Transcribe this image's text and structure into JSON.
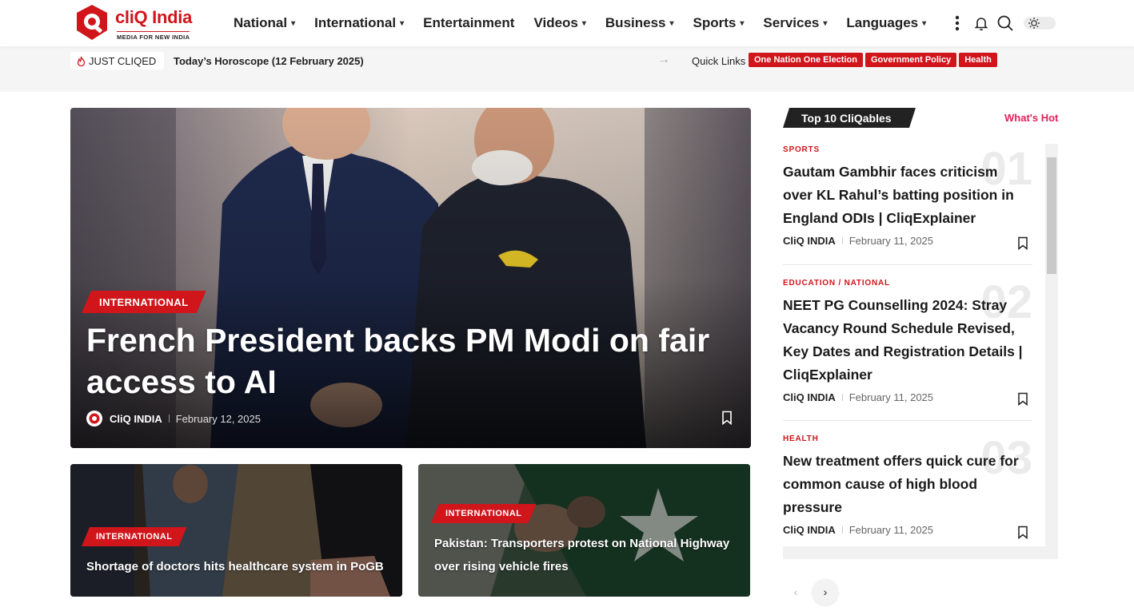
{
  "brand": {
    "name": "cliQ India",
    "tagline": "MEDIA FOR NEW INDIA"
  },
  "nav": [
    {
      "label": "National",
      "chevron": true
    },
    {
      "label": "International",
      "chevron": true
    },
    {
      "label": "Entertainment",
      "chevron": false
    },
    {
      "label": "Videos",
      "chevron": true
    },
    {
      "label": "Business",
      "chevron": true
    },
    {
      "label": "Sports",
      "chevron": true
    },
    {
      "label": "Services",
      "chevron": true
    },
    {
      "label": "Languages",
      "chevron": true
    }
  ],
  "ticker": {
    "label": "JUST CLIQED",
    "headline": "Today’s Horoscope (12 February 2025)",
    "quick_links_label": "Quick Links",
    "quick_links": [
      "One Nation One Election",
      "Government Policy",
      "Health"
    ]
  },
  "hero": {
    "category": "INTERNATIONAL",
    "title": "French President backs PM Modi on fair access to AI",
    "author": "CliQ INDIA",
    "date": "February 12, 2025"
  },
  "cards": [
    {
      "category": "INTERNATIONAL",
      "title": "Shortage of doctors hits healthcare system in PoGB"
    },
    {
      "category": "INTERNATIONAL",
      "title": "Pakistan: Transporters protest on National Highway over rising vehicle fires"
    }
  ],
  "sidebar": {
    "heading": "Top 10 CliQables",
    "whats_hot": "What's Hot",
    "items": [
      {
        "num": "01",
        "category": "SPORTS",
        "title": "Gautam Gambhir faces criticism over KL Rahul’s batting position in England ODIs | CliqExplainer",
        "author": "CliQ INDIA",
        "date": "February 11, 2025"
      },
      {
        "num": "02",
        "category": "EDUCATION / NATIONAL",
        "title": "NEET PG Counselling 2024: Stray Vacancy Round Schedule Revised, Key Dates and Registration Details | CliqExplainer",
        "author": "CliQ INDIA",
        "date": "February 11, 2025"
      },
      {
        "num": "03",
        "category": "HEALTH",
        "title": "New treatment offers quick cure for common cause of high blood pressure",
        "author": "CliQ INDIA",
        "date": "February 11, 2025"
      }
    ]
  },
  "icons": [
    "more-vertical-icon",
    "bell-icon",
    "search-icon",
    "sun-icon",
    "fire-icon",
    "arrow-right-icon",
    "bookmark-icon",
    "chevron-left-icon",
    "chevron-right-icon"
  ],
  "colors": {
    "brand_red": "#d0151b",
    "hot_pink": "#e0215a",
    "dark": "#222222"
  }
}
